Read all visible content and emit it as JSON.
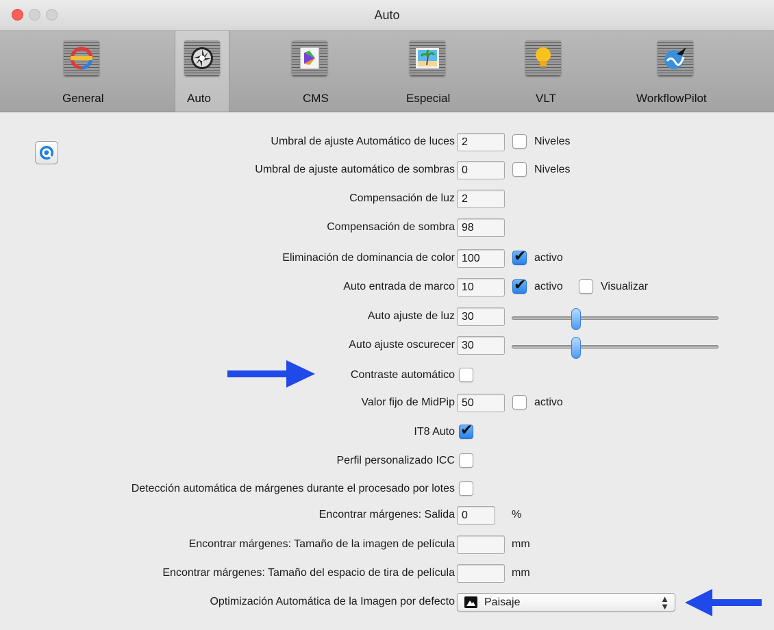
{
  "window": {
    "title": "Auto"
  },
  "toolbar": {
    "tabs": [
      {
        "label": "General",
        "icon": "general-icon"
      },
      {
        "label": "Auto",
        "icon": "auto-aperture-icon",
        "selected": true
      },
      {
        "label": "CMS",
        "icon": "cms-icon"
      },
      {
        "label": "Especial",
        "icon": "especial-beach-icon"
      },
      {
        "label": "VLT",
        "icon": "vlt-lightbulb-icon"
      },
      {
        "label": "WorkflowPilot",
        "icon": "workflowpilot-icon"
      }
    ]
  },
  "form": {
    "highlights_threshold": {
      "label": "Umbral de ajuste Automático de luces",
      "value": "2",
      "check_label": "Niveles",
      "checked": false
    },
    "shadows_threshold": {
      "label": "Umbral de ajuste automático de sombras",
      "value": "0",
      "check_label": "Niveles",
      "checked": false
    },
    "light_compensation": {
      "label": "Compensación de luz",
      "value": "2"
    },
    "shadow_compensation": {
      "label": "Compensación de sombra",
      "value": "98"
    },
    "color_cast_removal": {
      "label": "Eliminación de dominancia de color",
      "value": "100",
      "check_label": "activo",
      "checked": true
    },
    "auto_frame_entry": {
      "label": "Auto entrada de marco",
      "value": "10",
      "check_label": "activo",
      "checked": true,
      "check2_label": "Visualizar",
      "checked2": false
    },
    "auto_light_adjust": {
      "label": "Auto ajuste de luz",
      "value": "30",
      "slider_fraction": 0.31
    },
    "auto_darken_adjust": {
      "label": "Auto ajuste oscurecer",
      "value": "30",
      "slider_fraction": 0.31
    },
    "auto_contrast": {
      "label": "Contraste automático",
      "checked": false
    },
    "midpip_fixed": {
      "label": "Valor fijo de MidPip",
      "value": "50",
      "check_label": "activo",
      "checked": false
    },
    "it8_auto": {
      "label": "IT8 Auto",
      "checked": true
    },
    "custom_icc": {
      "label": "Perfil personalizado ICC",
      "checked": false
    },
    "batch_margin_detection": {
      "label": "Detección automática de márgenes durante el procesado por lotes",
      "checked": false
    },
    "margins_output": {
      "label": "Encontrar márgenes: Salida",
      "value": "0",
      "unit": "%"
    },
    "margins_image_size": {
      "label": "Encontrar márgenes: Tamaño de la imagen de película",
      "value": "",
      "unit": "mm"
    },
    "margins_strip_space": {
      "label": "Encontrar márgenes: Tamaño del espacio de tira de película",
      "value": "",
      "unit": "mm"
    },
    "default_optimization": {
      "label": "Optimización Automática de la Imagen por defecto",
      "selected": "Paisaje",
      "icon": "landscape-icon"
    }
  },
  "colors": {
    "annotation_arrow": "#1f49e8",
    "checkbox_checked": "#2a82ea"
  }
}
